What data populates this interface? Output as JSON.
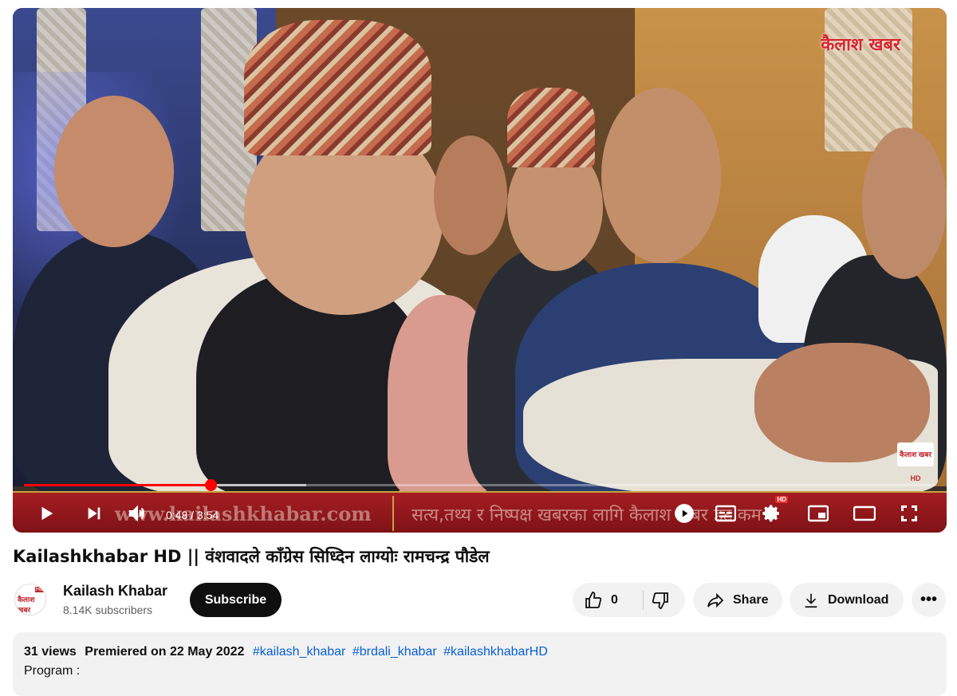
{
  "player": {
    "brand_logo": "कैलाश खबर",
    "corner_badge": "कैलाश खबर HD",
    "ticker_url": "www.kailashkhabar.com",
    "ticker_text": "सत्य,तथ्य र निष्पक्ष खबरका लागि कैलाश खबर डट कम",
    "current_time": "0:48",
    "duration": "3:54",
    "time_display": "0:48 / 3:54",
    "progress_fraction": 0.205,
    "buffered_fraction": 0.31,
    "hd_badge": "HD"
  },
  "video": {
    "title": "Kailashkhabar HD || वंशवादले काँग्रेस सिध्दिन लाग्योः रामचन्द्र पौडेल"
  },
  "channel": {
    "name": "Kailash Khabar",
    "subscribers": "8.14K subscribers",
    "avatar_text": "कैलाश खबर",
    "avatar_hd": "HD",
    "subscribe_label": "Subscribe"
  },
  "actions": {
    "like_count": "0",
    "share_label": "Share",
    "download_label": "Download",
    "more_label": "•••"
  },
  "description": {
    "views": "31 views",
    "premiered": "Premiered on 22 May 2022",
    "tags": [
      "#kailash_khabar",
      "#brdali_khabar",
      "#kailashkhabarHD"
    ],
    "program_label": "Program :"
  },
  "colors": {
    "accent_red": "#ff0000",
    "link_blue": "#065fd4",
    "ticker_red": "#a51d22"
  },
  "icons": [
    "play-icon",
    "next-icon",
    "volume-icon",
    "miniplayer-play-icon",
    "captions-icon",
    "settings-icon",
    "miniplayer-icon",
    "theater-icon",
    "fullscreen-icon",
    "like-icon",
    "dislike-icon",
    "share-icon",
    "download-icon"
  ]
}
